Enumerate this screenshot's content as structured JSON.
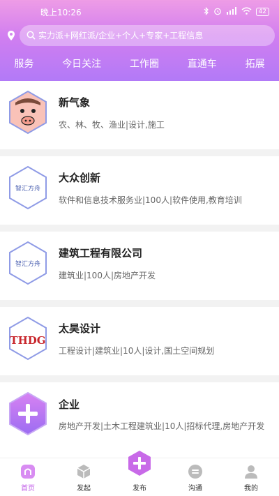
{
  "status_bar": {
    "time": "晚上10:26",
    "battery": "42"
  },
  "search": {
    "placeholder": "实力派+网红派/企业+个人+专家+工程信息"
  },
  "nav_tabs": [
    {
      "label": "服务"
    },
    {
      "label": "今日关注"
    },
    {
      "label": "工作圈"
    },
    {
      "label": "直通车"
    },
    {
      "label": "拓展"
    }
  ],
  "companies": [
    {
      "name": "新气象",
      "desc": "农、林、牧、渔业|设计,施工",
      "logo": "pig-avatar"
    },
    {
      "name": "大众创新",
      "desc": "软件和信息技术服务业|100人|软件使用,教育培训",
      "logo": "智汇方舟"
    },
    {
      "name": "建筑工程有限公司",
      "desc": "建筑业|100人|房地产开发",
      "logo": "智汇方舟"
    },
    {
      "name": "太昊设计",
      "desc": "工程设计|建筑业|10人|设计,国土空间规划",
      "logo": "THDG"
    },
    {
      "name": "企业",
      "desc": "房地产开发|土木工程建筑业|10人|招标代理,房地产开发",
      "logo": "plus-logo"
    }
  ],
  "bottom_nav": [
    {
      "label": "首页",
      "icon": "home-icon"
    },
    {
      "label": "发起",
      "icon": "cube-icon"
    },
    {
      "label": "发布",
      "icon": "plus-icon"
    },
    {
      "label": "沟通",
      "icon": "chat-icon"
    },
    {
      "label": "我的",
      "icon": "user-icon"
    }
  ],
  "colors": {
    "header_top": "#ee9ce6",
    "header_bottom": "#b27af7",
    "accent": "#c15ee8",
    "hex_border": "#8f9be6"
  }
}
